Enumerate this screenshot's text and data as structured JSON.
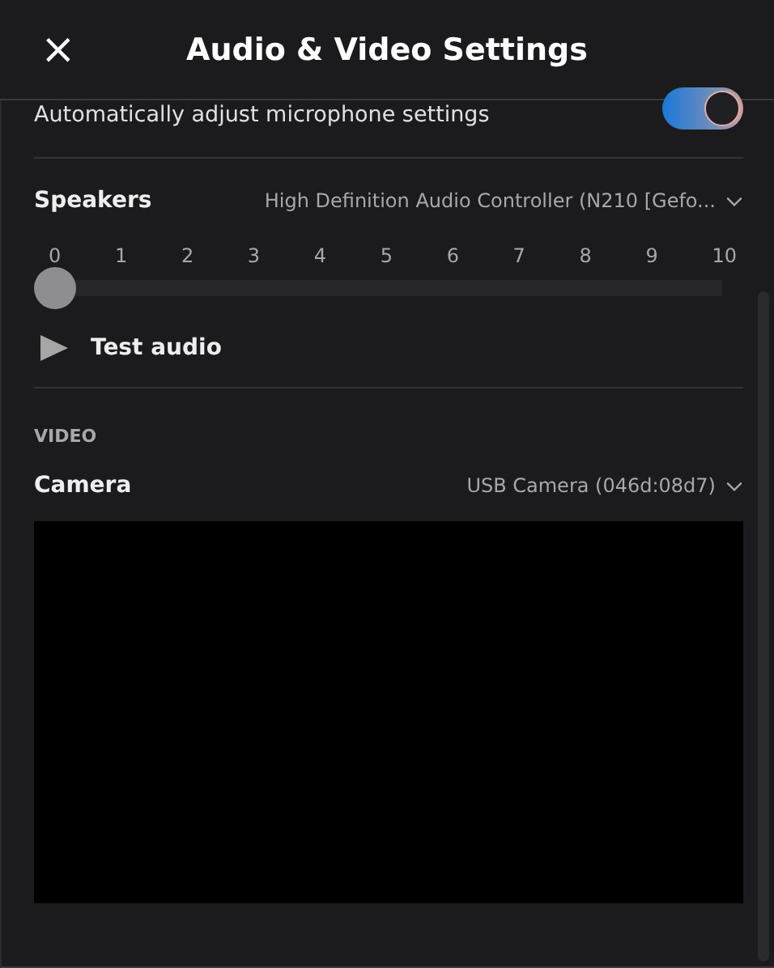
{
  "header": {
    "title": "Audio & Video Settings",
    "close": "×"
  },
  "auto_adjust": {
    "label": "Automatically adjust microphone settings",
    "on": true
  },
  "speakers": {
    "label": "Speakers",
    "device": "High Definition Audio Controller (N210 [Gefo...",
    "ticks": [
      "0",
      "1",
      "2",
      "3",
      "4",
      "5",
      "6",
      "7",
      "8",
      "9",
      "10"
    ],
    "level": 0
  },
  "test_audio": {
    "label": "Test audio"
  },
  "video": {
    "heading": "VIDEO",
    "camera_label": "Camera",
    "camera_device": "USB Camera (046d:08d7)"
  }
}
